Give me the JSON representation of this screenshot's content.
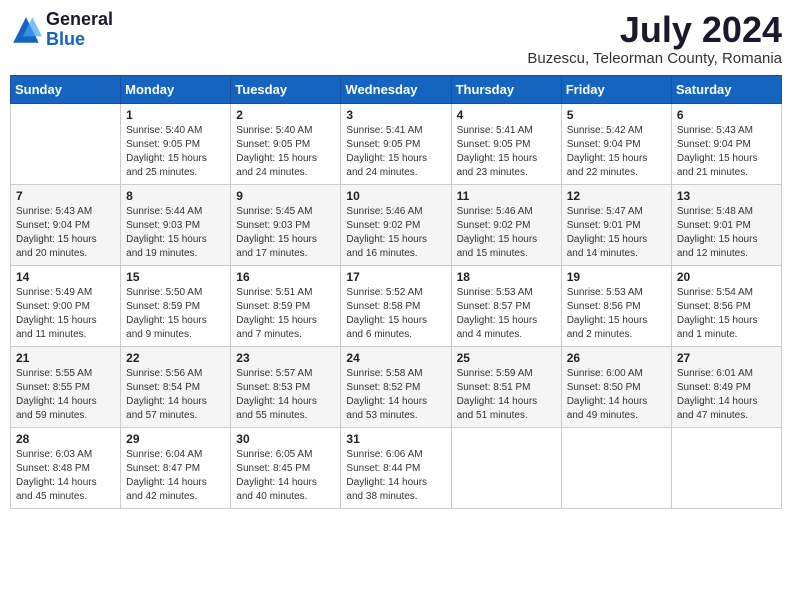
{
  "header": {
    "logo_general": "General",
    "logo_blue": "Blue",
    "month": "July 2024",
    "location": "Buzescu, Teleorman County, Romania"
  },
  "weekdays": [
    "Sunday",
    "Monday",
    "Tuesday",
    "Wednesday",
    "Thursday",
    "Friday",
    "Saturday"
  ],
  "weeks": [
    [
      {
        "day": "",
        "sunrise": "",
        "sunset": "",
        "daylight": ""
      },
      {
        "day": "1",
        "sunrise": "Sunrise: 5:40 AM",
        "sunset": "Sunset: 9:05 PM",
        "daylight": "Daylight: 15 hours and 25 minutes."
      },
      {
        "day": "2",
        "sunrise": "Sunrise: 5:40 AM",
        "sunset": "Sunset: 9:05 PM",
        "daylight": "Daylight: 15 hours and 24 minutes."
      },
      {
        "day": "3",
        "sunrise": "Sunrise: 5:41 AM",
        "sunset": "Sunset: 9:05 PM",
        "daylight": "Daylight: 15 hours and 24 minutes."
      },
      {
        "day": "4",
        "sunrise": "Sunrise: 5:41 AM",
        "sunset": "Sunset: 9:05 PM",
        "daylight": "Daylight: 15 hours and 23 minutes."
      },
      {
        "day": "5",
        "sunrise": "Sunrise: 5:42 AM",
        "sunset": "Sunset: 9:04 PM",
        "daylight": "Daylight: 15 hours and 22 minutes."
      },
      {
        "day": "6",
        "sunrise": "Sunrise: 5:43 AM",
        "sunset": "Sunset: 9:04 PM",
        "daylight": "Daylight: 15 hours and 21 minutes."
      }
    ],
    [
      {
        "day": "7",
        "sunrise": "Sunrise: 5:43 AM",
        "sunset": "Sunset: 9:04 PM",
        "daylight": "Daylight: 15 hours and 20 minutes."
      },
      {
        "day": "8",
        "sunrise": "Sunrise: 5:44 AM",
        "sunset": "Sunset: 9:03 PM",
        "daylight": "Daylight: 15 hours and 19 minutes."
      },
      {
        "day": "9",
        "sunrise": "Sunrise: 5:45 AM",
        "sunset": "Sunset: 9:03 PM",
        "daylight": "Daylight: 15 hours and 17 minutes."
      },
      {
        "day": "10",
        "sunrise": "Sunrise: 5:46 AM",
        "sunset": "Sunset: 9:02 PM",
        "daylight": "Daylight: 15 hours and 16 minutes."
      },
      {
        "day": "11",
        "sunrise": "Sunrise: 5:46 AM",
        "sunset": "Sunset: 9:02 PM",
        "daylight": "Daylight: 15 hours and 15 minutes."
      },
      {
        "day": "12",
        "sunrise": "Sunrise: 5:47 AM",
        "sunset": "Sunset: 9:01 PM",
        "daylight": "Daylight: 15 hours and 14 minutes."
      },
      {
        "day": "13",
        "sunrise": "Sunrise: 5:48 AM",
        "sunset": "Sunset: 9:01 PM",
        "daylight": "Daylight: 15 hours and 12 minutes."
      }
    ],
    [
      {
        "day": "14",
        "sunrise": "Sunrise: 5:49 AM",
        "sunset": "Sunset: 9:00 PM",
        "daylight": "Daylight: 15 hours and 11 minutes."
      },
      {
        "day": "15",
        "sunrise": "Sunrise: 5:50 AM",
        "sunset": "Sunset: 8:59 PM",
        "daylight": "Daylight: 15 hours and 9 minutes."
      },
      {
        "day": "16",
        "sunrise": "Sunrise: 5:51 AM",
        "sunset": "Sunset: 8:59 PM",
        "daylight": "Daylight: 15 hours and 7 minutes."
      },
      {
        "day": "17",
        "sunrise": "Sunrise: 5:52 AM",
        "sunset": "Sunset: 8:58 PM",
        "daylight": "Daylight: 15 hours and 6 minutes."
      },
      {
        "day": "18",
        "sunrise": "Sunrise: 5:53 AM",
        "sunset": "Sunset: 8:57 PM",
        "daylight": "Daylight: 15 hours and 4 minutes."
      },
      {
        "day": "19",
        "sunrise": "Sunrise: 5:53 AM",
        "sunset": "Sunset: 8:56 PM",
        "daylight": "Daylight: 15 hours and 2 minutes."
      },
      {
        "day": "20",
        "sunrise": "Sunrise: 5:54 AM",
        "sunset": "Sunset: 8:56 PM",
        "daylight": "Daylight: 15 hours and 1 minute."
      }
    ],
    [
      {
        "day": "21",
        "sunrise": "Sunrise: 5:55 AM",
        "sunset": "Sunset: 8:55 PM",
        "daylight": "Daylight: 14 hours and 59 minutes."
      },
      {
        "day": "22",
        "sunrise": "Sunrise: 5:56 AM",
        "sunset": "Sunset: 8:54 PM",
        "daylight": "Daylight: 14 hours and 57 minutes."
      },
      {
        "day": "23",
        "sunrise": "Sunrise: 5:57 AM",
        "sunset": "Sunset: 8:53 PM",
        "daylight": "Daylight: 14 hours and 55 minutes."
      },
      {
        "day": "24",
        "sunrise": "Sunrise: 5:58 AM",
        "sunset": "Sunset: 8:52 PM",
        "daylight": "Daylight: 14 hours and 53 minutes."
      },
      {
        "day": "25",
        "sunrise": "Sunrise: 5:59 AM",
        "sunset": "Sunset: 8:51 PM",
        "daylight": "Daylight: 14 hours and 51 minutes."
      },
      {
        "day": "26",
        "sunrise": "Sunrise: 6:00 AM",
        "sunset": "Sunset: 8:50 PM",
        "daylight": "Daylight: 14 hours and 49 minutes."
      },
      {
        "day": "27",
        "sunrise": "Sunrise: 6:01 AM",
        "sunset": "Sunset: 8:49 PM",
        "daylight": "Daylight: 14 hours and 47 minutes."
      }
    ],
    [
      {
        "day": "28",
        "sunrise": "Sunrise: 6:03 AM",
        "sunset": "Sunset: 8:48 PM",
        "daylight": "Daylight: 14 hours and 45 minutes."
      },
      {
        "day": "29",
        "sunrise": "Sunrise: 6:04 AM",
        "sunset": "Sunset: 8:47 PM",
        "daylight": "Daylight: 14 hours and 42 minutes."
      },
      {
        "day": "30",
        "sunrise": "Sunrise: 6:05 AM",
        "sunset": "Sunset: 8:45 PM",
        "daylight": "Daylight: 14 hours and 40 minutes."
      },
      {
        "day": "31",
        "sunrise": "Sunrise: 6:06 AM",
        "sunset": "Sunset: 8:44 PM",
        "daylight": "Daylight: 14 hours and 38 minutes."
      },
      {
        "day": "",
        "sunrise": "",
        "sunset": "",
        "daylight": ""
      },
      {
        "day": "",
        "sunrise": "",
        "sunset": "",
        "daylight": ""
      },
      {
        "day": "",
        "sunrise": "",
        "sunset": "",
        "daylight": ""
      }
    ]
  ]
}
